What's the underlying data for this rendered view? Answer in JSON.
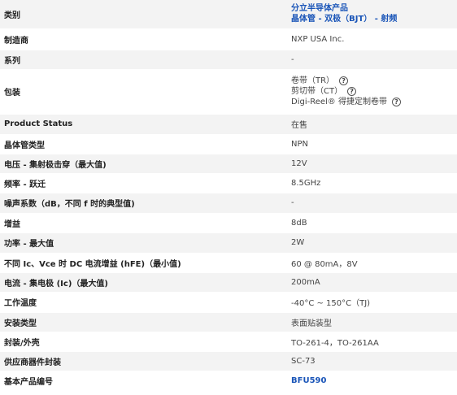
{
  "rows": [
    {
      "label": "类别",
      "value": [
        "分立半导体产品",
        "晶体管 - 双极（BJT） - 射频"
      ],
      "type": "link"
    },
    {
      "label": "制造商",
      "value": "NXP USA Inc."
    },
    {
      "label": "系列",
      "value": "-"
    },
    {
      "label": "包装",
      "value": [
        "卷带（TR）",
        "剪切带（CT）",
        "Digi-Reel® 得捷定制卷带"
      ],
      "type": "packaging",
      "icon": "help-circle-icon"
    },
    {
      "label": "Product Status",
      "value": "在售"
    },
    {
      "label": "晶体管类型",
      "value": "NPN"
    },
    {
      "label": "电压 - 集射极击穿（最大值)",
      "value": "12V"
    },
    {
      "label": "频率 - 跃迁",
      "value": "8.5GHz"
    },
    {
      "label": "噪声系数（dB，不同 f 时的典型值)",
      "value": "-"
    },
    {
      "label": "增益",
      "value": "8dB"
    },
    {
      "label": "功率 - 最大值",
      "value": "2W"
    },
    {
      "label": "不同 Ic、Vce 时 DC 电流增益 (hFE)（最小值)",
      "value": "60 @ 80mA，8V"
    },
    {
      "label": "电流 - 集电极 (Ic)（最大值)",
      "value": "200mA"
    },
    {
      "label": "工作温度",
      "value": "-40°C ~ 150°C（TJ)"
    },
    {
      "label": "安装类型",
      "value": "表面贴装型"
    },
    {
      "label": "封装/外壳",
      "value": "TO-261-4，TO-261AA"
    },
    {
      "label": "供应商器件封装",
      "value": "SC-73"
    },
    {
      "label": "基本产品编号",
      "value": "BFU590",
      "type": "link"
    }
  ]
}
